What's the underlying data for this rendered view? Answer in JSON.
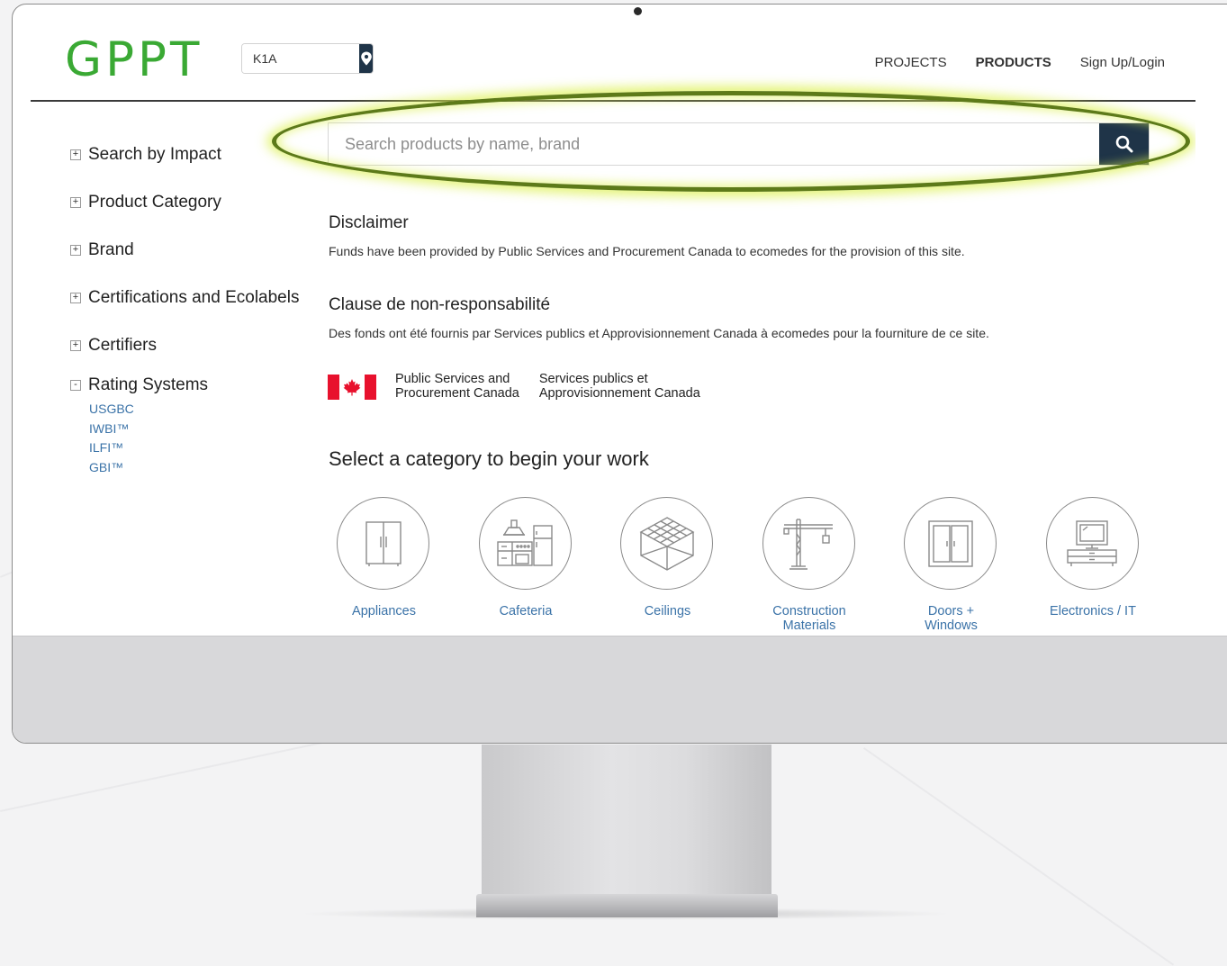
{
  "header": {
    "logo": "GPPT",
    "zip_value": "K1A",
    "nav": {
      "projects": "PROJECTS",
      "products": "PRODUCTS",
      "signup": "Sign Up/Login"
    }
  },
  "search": {
    "placeholder": "Search products by name, brand"
  },
  "sidebar": {
    "filters": [
      {
        "label": "Search by Impact",
        "toggle": "+"
      },
      {
        "label": "Product Category",
        "toggle": "+"
      },
      {
        "label": "Brand",
        "toggle": "+"
      },
      {
        "label": "Certifications and Ecolabels",
        "toggle": "+"
      },
      {
        "label": "Certifiers",
        "toggle": "+"
      },
      {
        "label": "Rating Systems",
        "toggle": "-"
      }
    ],
    "rating_systems": [
      "USGBC",
      "IWBI™",
      "ILFI™",
      "GBI™"
    ]
  },
  "disclaimer": {
    "en_title": "Disclaimer",
    "en_text": "Funds have been provided by Public Services and Procurement Canada to ecomedes for the provision of this site.",
    "fr_title": "Clause de non-responsabilité",
    "fr_text": "Des fonds ont été fournis par Services publics et Approvisionnement Canada à ecomedes pour la fourniture de ce site."
  },
  "government": {
    "en_line1": "Public Services and",
    "en_line2": "Procurement Canada",
    "fr_line1": "Services publics et",
    "fr_line2": "Approvisionnement Canada"
  },
  "categories_heading": "Select a category to begin your work",
  "categories": [
    {
      "label": "Appliances",
      "icon": "refrigerator-icon"
    },
    {
      "label": "Cafeteria",
      "icon": "kitchen-icon"
    },
    {
      "label": "Ceilings",
      "icon": "ceiling-tile-icon"
    },
    {
      "label": "Construction Materials",
      "icon": "crane-icon"
    },
    {
      "label": "Doors + Windows",
      "icon": "door-icon"
    },
    {
      "label": "Electronics / IT",
      "icon": "computer-icon"
    }
  ],
  "colors": {
    "logo": "#3aa934",
    "accent_dark": "#1f3448",
    "link": "#3b73a8",
    "highlight_ring": "#5d7a19",
    "flag_red": "#e8112d"
  }
}
